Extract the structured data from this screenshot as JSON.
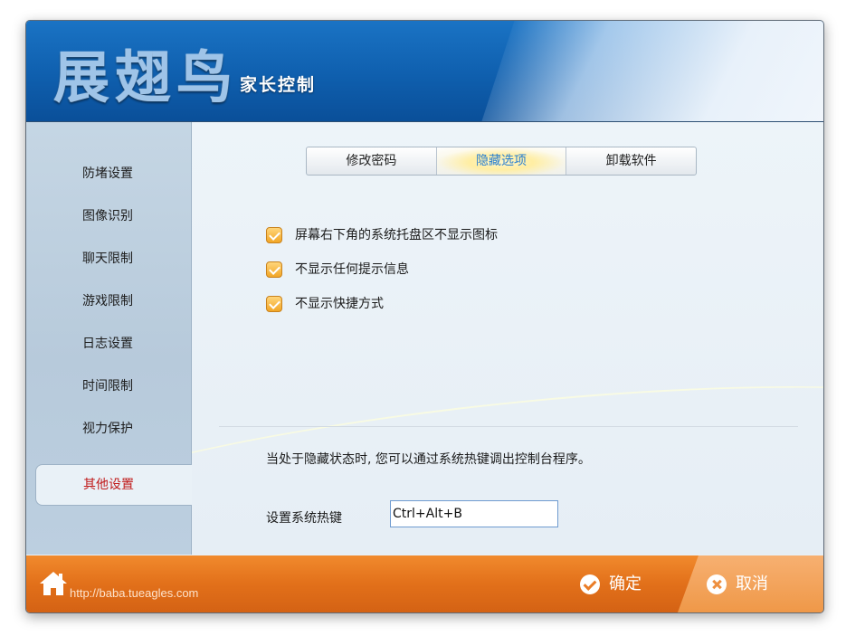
{
  "header": {
    "logo": "展翅鸟",
    "subtitle": "家长控制"
  },
  "sidebar": {
    "items": [
      {
        "label": "防堵设置"
      },
      {
        "label": "图像识别"
      },
      {
        "label": "聊天限制"
      },
      {
        "label": "游戏限制"
      },
      {
        "label": "日志设置"
      },
      {
        "label": "时间限制"
      },
      {
        "label": "视力保护"
      },
      {
        "label": "其他设置"
      }
    ],
    "active_index": 7
  },
  "tabs": [
    {
      "label": "修改密码"
    },
    {
      "label": "隐藏选项"
    },
    {
      "label": "卸载软件"
    }
  ],
  "options": [
    {
      "label": "屏幕右下角的系统托盘区不显示图标",
      "checked": true
    },
    {
      "label": "不显示任何提示信息",
      "checked": true
    },
    {
      "label": "不显示快捷方式",
      "checked": true
    }
  ],
  "info_text": "当处于隐藏状态时, 您可以通过系统热键调出控制台程序。",
  "hotkey": {
    "label": "设置系统热键",
    "value": "Ctrl+Alt+B"
  },
  "footer": {
    "url": "http://baba.tueagles.com",
    "ok_label": "确定",
    "cancel_label": "取消"
  },
  "colors": {
    "header": "#0f5fae",
    "footer": "#e2701a",
    "active_item": "#c01a1a",
    "active_tab": "#2a7fd0"
  }
}
